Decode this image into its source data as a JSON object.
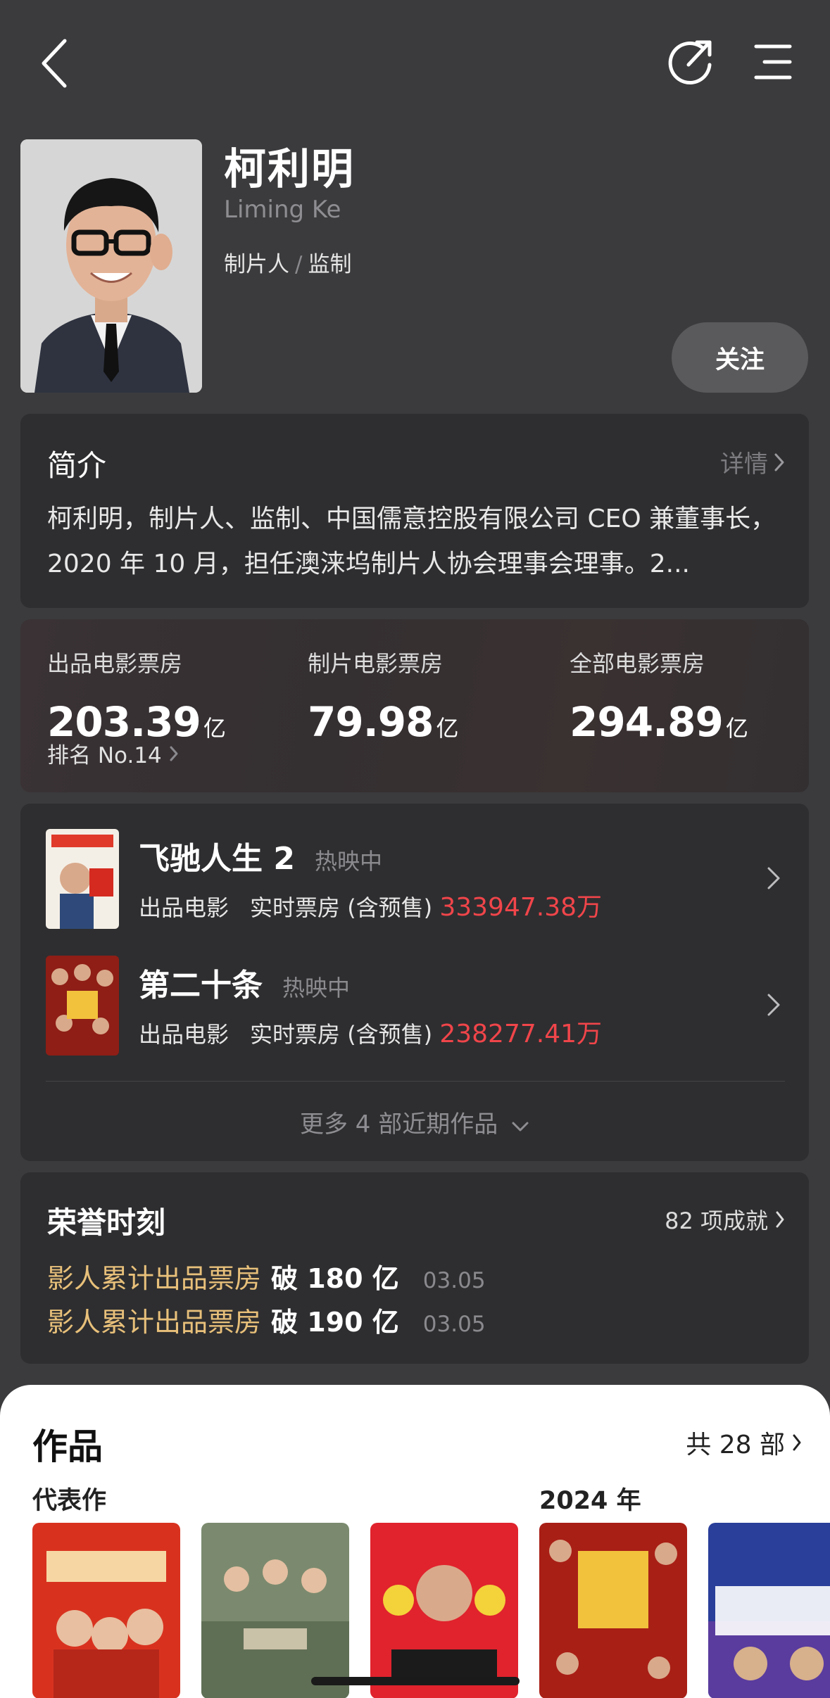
{
  "nav": {
    "back_icon": "chevron-left-icon",
    "share_icon": "share-icon",
    "menu_icon": "menu-icon"
  },
  "profile": {
    "name": "柯利明",
    "name_en": "Liming Ke",
    "role_1": "制片人",
    "role_sep": "/",
    "role_2": "监制",
    "follow_label": "关注"
  },
  "intro": {
    "title": "简介",
    "more_label": "详情",
    "text": "柯利明，制片人、监制、中国儒意控股有限公司 CEO 兼董事长，2020 年 10 月，担任澳涞坞制片人协会理事会理事。2..."
  },
  "stats": {
    "items": [
      {
        "label": "出品电影票房",
        "value": "203.39",
        "unit": "亿"
      },
      {
        "label": "制片电影票房",
        "value": "79.98",
        "unit": "亿"
      },
      {
        "label": "全部电影票房",
        "value": "294.89",
        "unit": "亿"
      }
    ],
    "rank": "排名 No.14"
  },
  "films": {
    "items": [
      {
        "title": "飞驰人生 2",
        "status": "热映中",
        "type": "出品电影",
        "box_label": "实时票房 (含预售)",
        "box_value": "333947.38万"
      },
      {
        "title": "第二十条",
        "status": "热映中",
        "type": "出品电影",
        "box_label": "实时票房 (含预售)",
        "box_value": "238277.41万"
      }
    ],
    "more_label": "更多 4 部近期作品"
  },
  "honors": {
    "title": "荣誉时刻",
    "count_label": "82 项成就",
    "items": [
      {
        "text": "影人累计出品票房",
        "strong": "破 180 亿",
        "date": "03.05"
      },
      {
        "text": "影人累计出品票房",
        "strong": "破 190 亿",
        "date": "03.05"
      }
    ]
  },
  "works": {
    "title": "作品",
    "count_label": "共 28 部",
    "label_representative": "代表作",
    "label_year": "2024 年"
  },
  "colors": {
    "background": "#3b3b3d",
    "card": "#2e2e30",
    "box_office_red": "#f0454a",
    "honor_gold": "#e8c07a"
  }
}
